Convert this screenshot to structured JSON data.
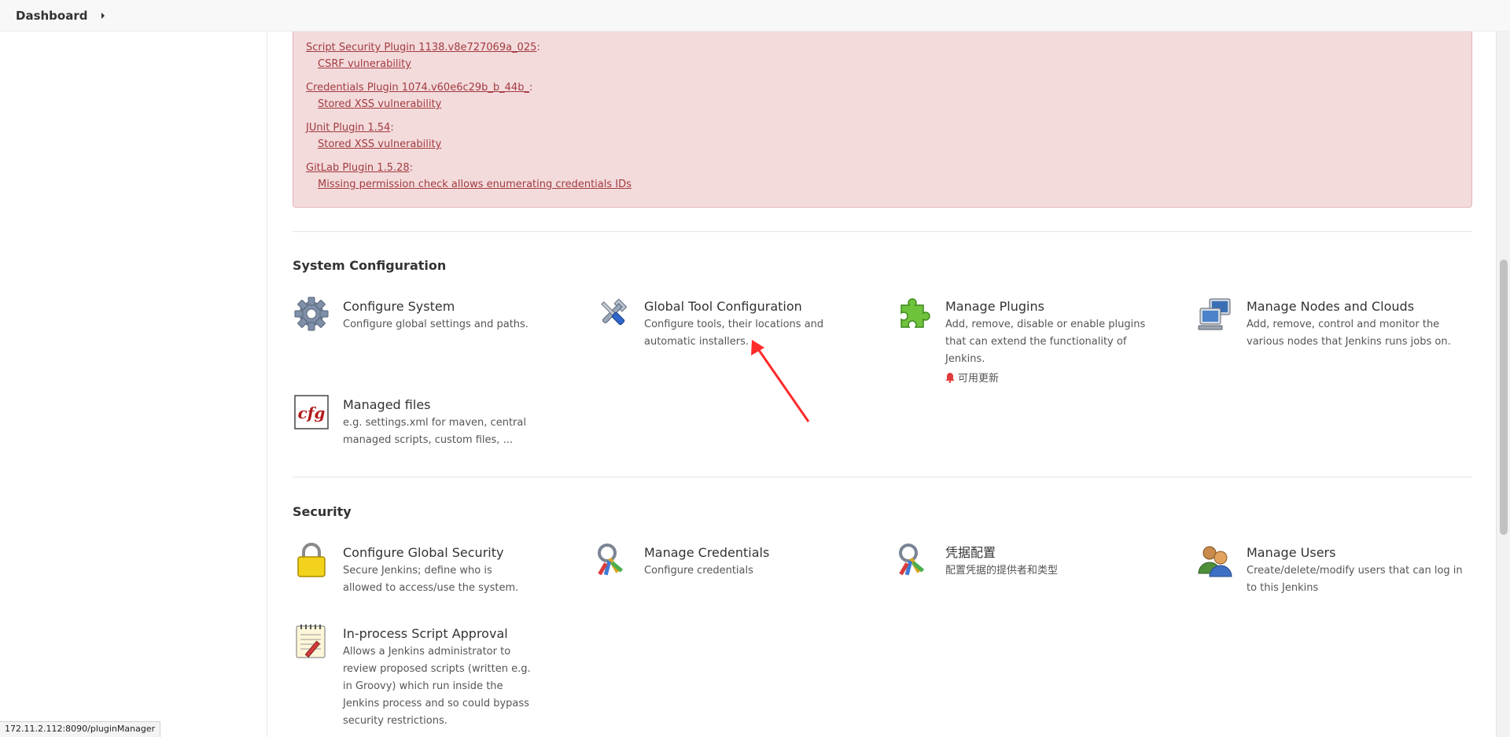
{
  "breadcrumb": {
    "dashboard": "Dashboard"
  },
  "alert": {
    "items": [
      {
        "plugin": "Script Security Plugin 1138.v8e727069a_025",
        "vuln": "CSRF vulnerability"
      },
      {
        "plugin": "Credentials Plugin 1074.v60e6c29b_b_44b_",
        "vuln": "Stored XSS vulnerability"
      },
      {
        "plugin": "JUnit Plugin 1.54",
        "vuln": "Stored XSS vulnerability"
      },
      {
        "plugin": "GitLab Plugin 1.5.28",
        "vuln": "Missing permission check allows enumerating credentials IDs"
      }
    ]
  },
  "system_config": {
    "title": "System Configuration",
    "tiles": [
      {
        "title": "Configure System",
        "desc": "Configure global settings and paths.",
        "icon": "gear-icon"
      },
      {
        "title": "Global Tool Configuration",
        "desc": "Configure tools, their locations and automatic installers.",
        "icon": "tools-icon"
      },
      {
        "title": "Manage Plugins",
        "desc": "Add, remove, disable or enable plugins that can extend the functionality of Jenkins.",
        "badge": "可用更新",
        "icon": "puzzle-icon"
      },
      {
        "title": "Manage Nodes and Clouds",
        "desc": "Add, remove, control and monitor the various nodes that Jenkins runs jobs on.",
        "icon": "computer-icon"
      },
      {
        "title": "Managed files",
        "desc": "e.g. settings.xml for maven, central managed scripts, custom files, ...",
        "icon": "cfg-icon"
      }
    ]
  },
  "security": {
    "title": "Security",
    "tiles": [
      {
        "title": "Configure Global Security",
        "desc": "Secure Jenkins; define who is allowed to access/use the system.",
        "icon": "lock-icon"
      },
      {
        "title": "Manage Credentials",
        "desc": "Configure credentials",
        "icon": "keys-icon"
      },
      {
        "title": "凭据配置",
        "desc": "配置凭据的提供者和类型",
        "icon": "keys-icon"
      },
      {
        "title": "Manage Users",
        "desc": "Create/delete/modify users that can log in to this Jenkins",
        "icon": "users-icon"
      },
      {
        "title": "In-process Script Approval",
        "desc": "Allows a Jenkins administrator to review proposed scripts (written e.g. in Groovy) which run inside the Jenkins process and so could bypass security restrictions.",
        "icon": "notepad-icon"
      }
    ]
  },
  "status_bar": {
    "url": "172.11.2.112:8090/pluginManager"
  },
  "colors": {
    "alert_bg": "#f3dbdc",
    "alert_link": "#a33b3f",
    "annotation_arrow": "#ff2a2a"
  }
}
